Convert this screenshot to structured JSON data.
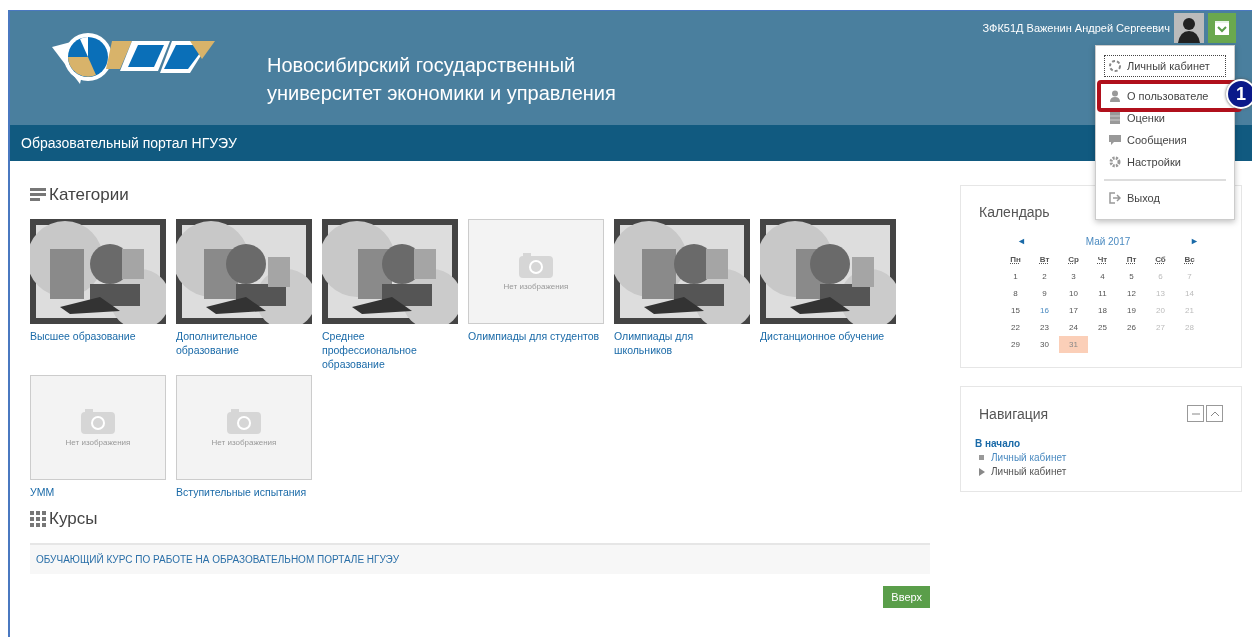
{
  "header": {
    "title_lines": [
      "Новосибирский государственный",
      "университет экономики и управления"
    ],
    "user_name": "ЗФК51Д Важенин Андрей Сергеевич"
  },
  "user_menu": {
    "items": [
      {
        "label": "Личный кабинет",
        "focused": true
      },
      {
        "label": "О пользователе",
        "focused": false,
        "annotation": "1"
      },
      {
        "label": "Оценки",
        "focused": false
      },
      {
        "label": "Сообщения",
        "focused": false
      },
      {
        "label": "Настройки",
        "focused": false
      }
    ],
    "footer_items": [
      {
        "label": "Выход"
      }
    ]
  },
  "navbar": {
    "brand": "Образовательный портал НГУЭУ"
  },
  "categories": {
    "title": "Категории",
    "items": [
      {
        "label": "Высшее образование",
        "kind": "picture"
      },
      {
        "label": "Дополнительное образование",
        "kind": "picture"
      },
      {
        "label": "Среднее профессиональное образование",
        "kind": "picture"
      },
      {
        "label": "Олимпиады для студентов",
        "kind": "placeholder",
        "placeholder_text": "Нет изображения"
      },
      {
        "label": "Олимпиады для школьников",
        "kind": "picture"
      },
      {
        "label": "Дистанционное обучение",
        "kind": "picture"
      },
      {
        "label": "УММ",
        "kind": "placeholder",
        "placeholder_text": "Нет изображения"
      },
      {
        "label": "Вступительные испытания",
        "kind": "placeholder",
        "placeholder_text": "Нет изображения"
      }
    ]
  },
  "courses": {
    "title": "Курсы",
    "items": [
      "ОБУЧАЮЩИЙ КУРС ПО РАБОТЕ НА ОБРАЗОВАТЕЛЬНОМ ПОРТАЛЕ НГУЭУ"
    ]
  },
  "back_to_top": "Вверх",
  "calendar": {
    "title": "Календарь",
    "prev": "◄",
    "month": "Май 2017",
    "next": "►",
    "weekdays": [
      "Пн",
      "Вт",
      "Ср",
      "Чт",
      "Пт",
      "Сб",
      "Вс"
    ],
    "weeks": [
      [
        {
          "day": "1",
          "kind": "normal"
        },
        {
          "day": "2",
          "kind": "normal"
        },
        {
          "day": "3",
          "kind": "normal"
        },
        {
          "day": "4",
          "kind": "normal"
        },
        {
          "day": "5",
          "kind": "normal"
        },
        {
          "day": "6",
          "kind": "weekend"
        },
        {
          "day": "7",
          "kind": "weekend"
        }
      ],
      [
        {
          "day": "8",
          "kind": "normal"
        },
        {
          "day": "9",
          "kind": "normal"
        },
        {
          "day": "10",
          "kind": "normal"
        },
        {
          "day": "11",
          "kind": "normal"
        },
        {
          "day": "12",
          "kind": "normal"
        },
        {
          "day": "13",
          "kind": "weekend"
        },
        {
          "day": "14",
          "kind": "weekend"
        }
      ],
      [
        {
          "day": "15",
          "kind": "normal"
        },
        {
          "day": "16",
          "kind": "event"
        },
        {
          "day": "17",
          "kind": "normal"
        },
        {
          "day": "18",
          "kind": "normal"
        },
        {
          "day": "19",
          "kind": "normal"
        },
        {
          "day": "20",
          "kind": "weekend"
        },
        {
          "day": "21",
          "kind": "weekend"
        }
      ],
      [
        {
          "day": "22",
          "kind": "normal"
        },
        {
          "day": "23",
          "kind": "normal"
        },
        {
          "day": "24",
          "kind": "normal"
        },
        {
          "day": "25",
          "kind": "normal"
        },
        {
          "day": "26",
          "kind": "normal"
        },
        {
          "day": "27",
          "kind": "weekend"
        },
        {
          "day": "28",
          "kind": "weekend"
        }
      ],
      [
        {
          "day": "29",
          "kind": "normal"
        },
        {
          "day": "30",
          "kind": "normal"
        },
        {
          "day": "31",
          "kind": "today"
        }
      ]
    ]
  },
  "navigation": {
    "title": "Навигация",
    "home": "В начало",
    "items": [
      {
        "label": "Личный кабинет",
        "kind": "link"
      },
      {
        "label": "Личный кабинет",
        "kind": "branch"
      }
    ]
  }
}
